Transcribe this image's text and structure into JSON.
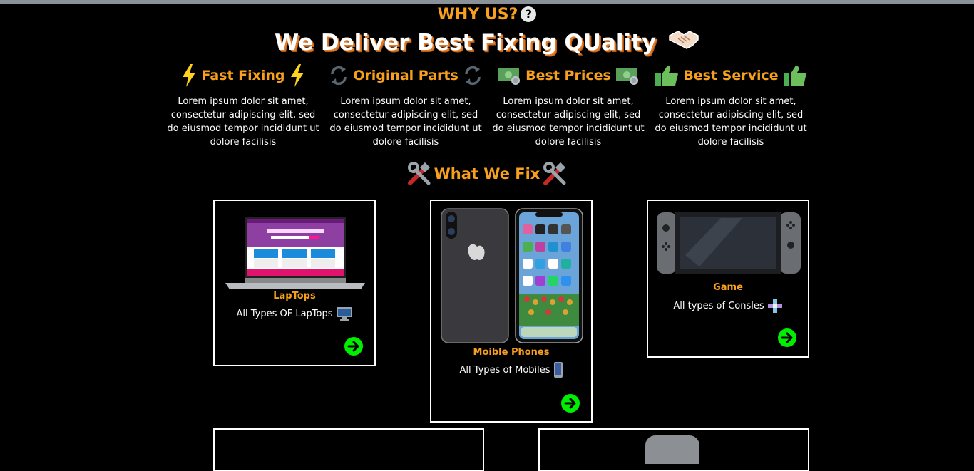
{
  "why": {
    "title": "WHY US?",
    "q": "?"
  },
  "headline": "We Deliver Best Fixing QUality",
  "features": [
    {
      "title": "Fast Fixing",
      "icon": "lightning-icon",
      "desc": "Lorem ipsum dolor sit amet, consectetur adipiscing elit, sed do eiusmod tempor incididunt ut dolore facilisis"
    },
    {
      "title": "Original Parts",
      "icon": "refresh-icon",
      "desc": "Lorem ipsum dolor sit amet, consectetur adipiscing elit, sed do eiusmod tempor incididunt ut dolore facilisis"
    },
    {
      "title": "Best Prices",
      "icon": "money-icon",
      "desc": "Lorem ipsum dolor sit amet, consectetur adipiscing elit, sed do eiusmod tempor incididunt ut dolore facilisis"
    },
    {
      "title": "Best Service",
      "icon": "thumbs-up-icon",
      "desc": "Lorem ipsum dolor sit amet, consectetur adipiscing elit, sed do eiusmod tempor incididunt ut dolore facilisis"
    }
  ],
  "what_we_fix": {
    "title": "What We Fix",
    "icon": "tools-icon"
  },
  "cards": [
    {
      "name": "LapTops",
      "desc": "All Types OF LapTops",
      "icon": "desktop-computer-icon"
    },
    {
      "name": "Moible Phones",
      "desc": "All Types of Mobiles",
      "icon": "mobile-phone-icon"
    },
    {
      "name": "Game",
      "desc": "All types of Consles",
      "icon": "gamepad-icon"
    }
  ],
  "colors": {
    "accent": "#f7a01d",
    "arrow": "#00ee00",
    "background": "#000000"
  }
}
